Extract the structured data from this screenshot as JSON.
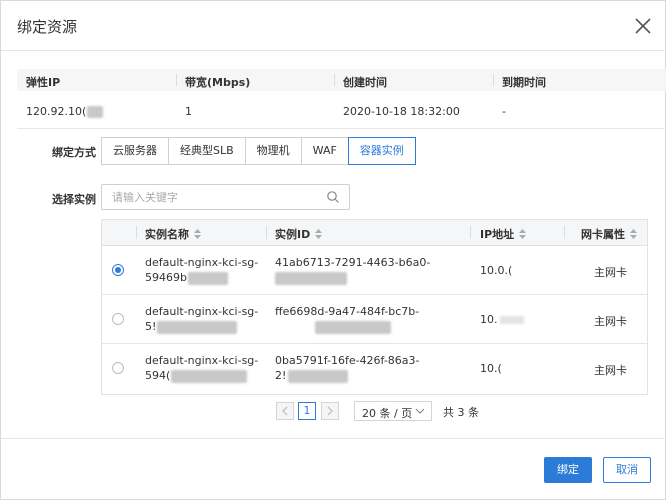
{
  "dialog": {
    "title": "绑定资源"
  },
  "resource": {
    "headers": [
      "弹性IP",
      "带宽(Mbps)",
      "创建时间",
      "到期时间"
    ],
    "row": {
      "ip": "120.92.10(",
      "bandwidth": "1",
      "created": "2020-10-18 18:32:00",
      "expires": "-"
    }
  },
  "bind": {
    "label": "绑定方式",
    "options": [
      "云服务器",
      "经典型SLB",
      "物理机",
      "WAF",
      "容器实例"
    ],
    "selected": "容器实例"
  },
  "search": {
    "label": "选择实例",
    "placeholder": "请输入关键字"
  },
  "instances": {
    "headers": [
      "实例名称",
      "实例ID",
      "IP地址",
      "网卡属性"
    ],
    "rows": [
      {
        "name1": "default-nginx-kci-sg-",
        "name2": "59469b",
        "id1": "41ab6713-7291-4463-b6a0-",
        "id2": "",
        "ip": "10.0.(",
        "nic": "主网卡",
        "selected": true
      },
      {
        "name1": "default-nginx-kci-sg-",
        "name2": "5!",
        "id1": "ffe6698d-9a47-484f-bc7b-",
        "id2": "",
        "ip": "10.",
        "nic": "主网卡",
        "selected": false
      },
      {
        "name1": "default-nginx-kci-sg-",
        "name2": "594(",
        "id1": "0ba5791f-16fe-426f-86a3-",
        "id2": "2!",
        "ip": "10.(",
        "nic": "主网卡",
        "selected": false
      }
    ]
  },
  "pagination": {
    "current": "1",
    "page_size": "20 条 / 页",
    "total": "共 3 条"
  },
  "footer": {
    "ok": "绑定",
    "cancel": "取消"
  },
  "colors": {
    "accent": "#2c7bd8"
  }
}
